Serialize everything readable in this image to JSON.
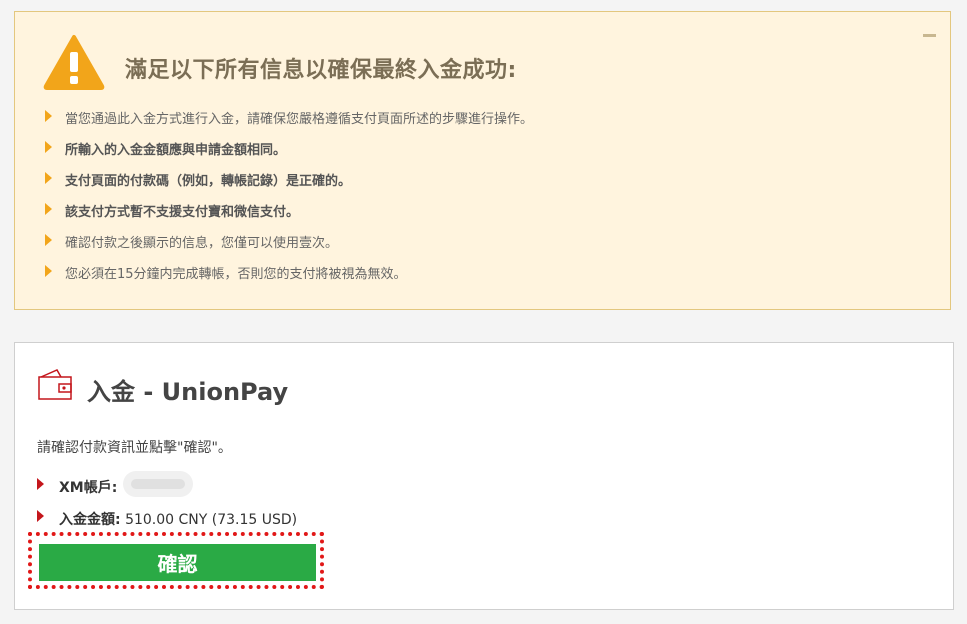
{
  "notice": {
    "title": "滿足以下所有信息以確保最終入金成功:",
    "collapse_icon": "minus-icon",
    "warning_icon": "warning-triangle-icon",
    "accent_color": "#f2a51a",
    "rules": [
      "當您通過此入金方式進行入金，請確保您嚴格遵循支付頁面所述的步驟進行操作。",
      "所輸入的入金金額應與申請金額相同。",
      "支付頁面的付款碼（例如，轉帳記錄）是正確的。",
      "該支付方式暫不支援支付寶和微信支付。",
      "確認付款之後顯示的信息，您僅可以使用壹次。",
      "您必須在15分鐘内完成轉帳，否則您的支付將被視為無效。"
    ]
  },
  "deposit": {
    "icon": "wallet-icon",
    "title": "入金 - UnionPay",
    "instruction": "請確認付款資訊並點擊\"確認\"。",
    "account_label": "XM帳戶:",
    "amount_label": "入金金額:",
    "amount_value": "510.00 CNY (73.15 USD)",
    "confirm_label": "確認",
    "confirm_color": "#2aaa45",
    "highlight_color": "#e11818"
  }
}
